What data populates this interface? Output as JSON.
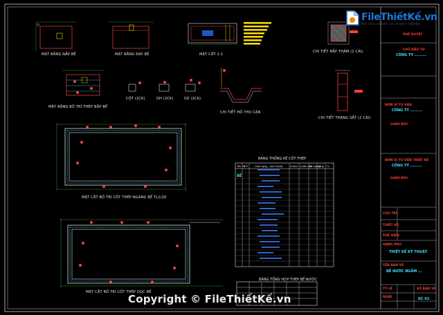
{
  "logo": {
    "brand": "FileThiếtKế.vn",
    "sub": "Nơi chia sẻ bản vẽ chuyên nghiệp"
  },
  "watermark": "Copyright © FileThiếtKế.vn",
  "drawings": {
    "plan_lid": "MẶT BẰNG NẮP BỂ",
    "plan_bottom": "MẶT BẰNG ĐÁY BỂ",
    "section_11": "MẶT CẮT 1-1",
    "detail_hatch": "CHI TIẾT NẮP THĂM (2 CÁI)",
    "plan_lid_rebar": "MẶT BẰNG BỐ TRÍ THÉP NẮP BỂ",
    "col_2ck": "CỘT (2CK)",
    "dh_2ck": "DH (2CK)",
    "dz_2ck": "DZ (2CK)",
    "detail_sump": "CHI TIẾT HỐ THU CẶN",
    "detail_ladder": "CHI TIẾT THANG SẮT (2 CÁI)",
    "section_horizontal": "MẶT CẮT BỐ TRÍ CỐT THÉP NGANG BỂ TL1/20",
    "section_vertical": "MẶT CẮT BỐ TRÍ CỐT THÉP DỌC BỂ"
  },
  "rebar_table": {
    "title": "BẢNG THỐNG KÊ CỐT THÉP",
    "headers": [
      "Tên CK",
      "STT",
      "Hình dạng - kích thước",
      "Đ.kính",
      "Chiều dài",
      "Số lượng",
      "Tổng",
      "T.L"
    ],
    "section_label": "BỂ"
  },
  "summary_table": {
    "title": "BẢNG TỔNG HỢP THÉP BỂ NƯỚC"
  },
  "title_block": {
    "approver_label": "PHÊ DUYỆT",
    "client_label": "CHỦ ĐẦU TƯ",
    "client_value": "CÔNG TY .........",
    "consultant_label": "ĐƠN VỊ TƯ VẤN",
    "consultant_value": "CÔNG TY .........",
    "consultant_dir_label": "GIÁM ĐỐC",
    "contractor_label": "ĐƠN VỊ TƯ VẤN THIẾT KẾ",
    "contractor_value": "CÔNG TY .........",
    "director_label": "GIÁM ĐỐC",
    "row_chief": "CHỦ TRÌ",
    "row_check": "THIẾT KẾ",
    "row_draw": "THỂ HIỆN",
    "category_label": "HẠNG MỤC",
    "category_value": "THIẾT KẾ KỸ THUẬT",
    "drawing_name_label": "TÊN BẢN VẼ",
    "drawing_name_value": "BỂ NƯỚC NGẦM ...",
    "sheet_no_label": "SỐ BẢN VẼ",
    "date_label": "NGÀY",
    "scale_label": "TỶ LỆ",
    "sheet_code": "KC-01"
  }
}
